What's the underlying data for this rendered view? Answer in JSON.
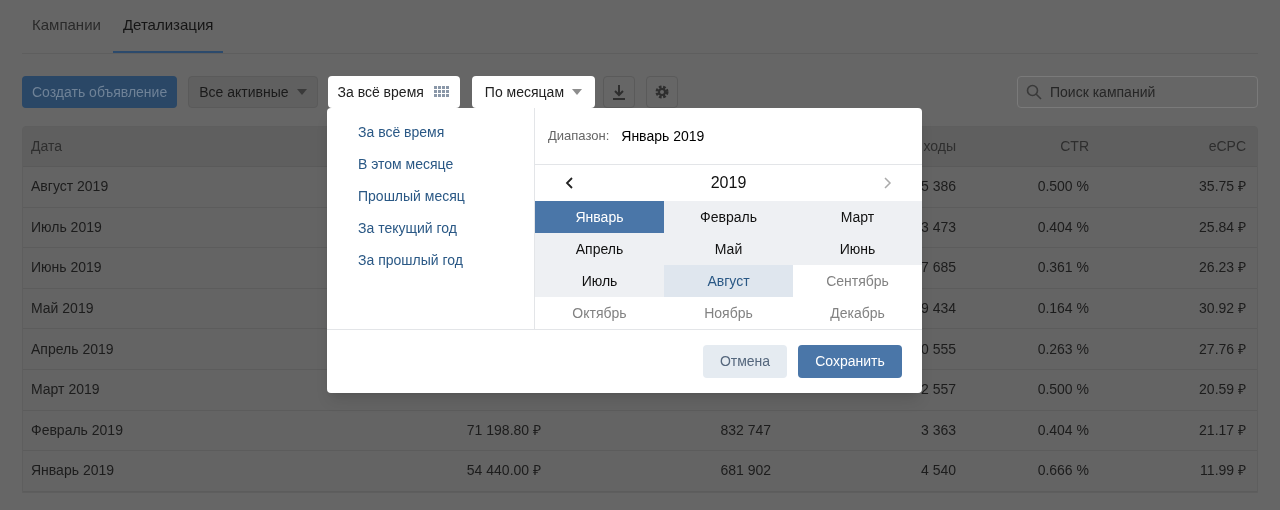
{
  "tabs": [
    {
      "label": "Кампании",
      "selected": false
    },
    {
      "label": "Детализация",
      "selected": true
    }
  ],
  "toolbar": {
    "create_button": "Создать объявление",
    "status_filter": "Все активные",
    "period_button": "За всё время",
    "grouping": "По месяцам",
    "search": {
      "placeholder": "Поиск кампаний"
    }
  },
  "table": {
    "columns": [
      "Дата",
      null,
      null,
      "ходы",
      "CTR",
      "eCPC"
    ],
    "rows": [
      [
        "Август 2019",
        null,
        null,
        "5 386",
        "0.500 %",
        "35.75 ₽"
      ],
      [
        "Июль 2019",
        null,
        null,
        "3 473",
        "0.404 %",
        "25.84 ₽"
      ],
      [
        "Июнь 2019",
        null,
        null,
        "7 685",
        "0.361 %",
        "26.23 ₽"
      ],
      [
        "Май 2019",
        null,
        null,
        "9 434",
        "0.164 %",
        "30.92 ₽"
      ],
      [
        "Апрель 2019",
        null,
        null,
        "0 555",
        "0.263 %",
        "27.76 ₽"
      ],
      [
        "Март 2019",
        null,
        null,
        "2 557",
        "0.500 %",
        "20.59 ₽"
      ],
      [
        "Февраль 2019",
        "71 198.80 ₽",
        "832 747",
        "3 363",
        "0.404 %",
        "21.17 ₽"
      ],
      [
        "Январь 2019",
        "54 440.00 ₽",
        "681 902",
        "4 540",
        "0.666 %",
        "11.99 ₽"
      ]
    ]
  },
  "popup": {
    "presets": [
      "За всё время",
      "В этом месяце",
      "Прошлый месяц",
      "За текущий год",
      "За прошлый год"
    ],
    "range_label": "Диапазон:",
    "range_value": "Январь 2019",
    "year": "2019",
    "months": [
      {
        "label": "Январь",
        "selected": true,
        "highlighted": false,
        "disabled": false
      },
      {
        "label": "Февраль",
        "selected": false,
        "highlighted": false,
        "disabled": false
      },
      {
        "label": "Март",
        "selected": false,
        "highlighted": false,
        "disabled": false
      },
      {
        "label": "Апрель",
        "selected": false,
        "highlighted": false,
        "disabled": false
      },
      {
        "label": "Май",
        "selected": false,
        "highlighted": false,
        "disabled": false
      },
      {
        "label": "Июнь",
        "selected": false,
        "highlighted": false,
        "disabled": false
      },
      {
        "label": "Июль",
        "selected": false,
        "highlighted": false,
        "disabled": false
      },
      {
        "label": "Август",
        "selected": false,
        "highlighted": true,
        "disabled": false
      },
      {
        "label": "Сентябрь",
        "selected": false,
        "highlighted": false,
        "disabled": true
      },
      {
        "label": "Октябрь",
        "selected": false,
        "highlighted": false,
        "disabled": true
      },
      {
        "label": "Ноябрь",
        "selected": false,
        "highlighted": false,
        "disabled": true
      },
      {
        "label": "Декабрь",
        "selected": false,
        "highlighted": false,
        "disabled": true
      }
    ],
    "cancel": "Отмена",
    "save": "Сохранить"
  }
}
